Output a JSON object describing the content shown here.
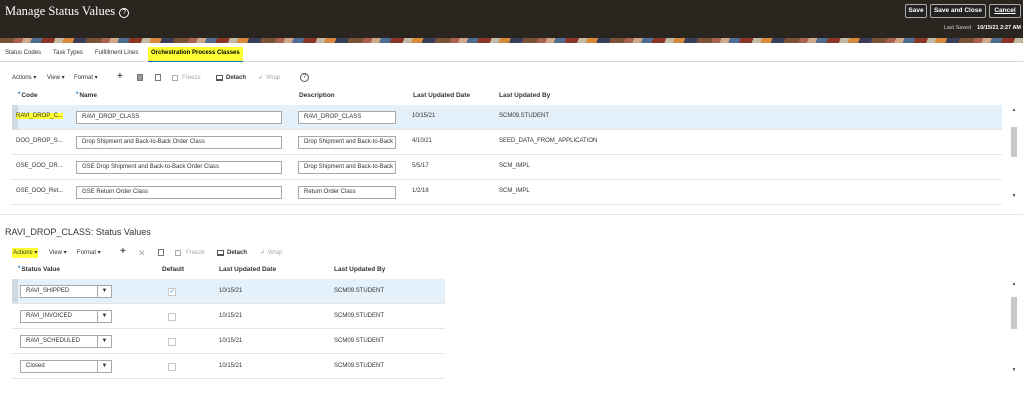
{
  "header": {
    "title": "Manage Status Values",
    "help_glyph": "?",
    "buttons": {
      "save": "Save",
      "save_close": "Save and Close",
      "cancel": "Cancel"
    },
    "last_saved_label": "Last Saved",
    "last_saved_value": "10/15/21 2:27 AM"
  },
  "tabs": [
    {
      "label": "Status Codes"
    },
    {
      "label": "Task Types"
    },
    {
      "label": "Fulfillment Lines"
    },
    {
      "label": "Orchestration Process Classes",
      "active": true
    }
  ],
  "toolbar1": {
    "actions": "Actions ▾",
    "view": "View ▾",
    "format": "Format ▾",
    "freeze": "Freeze",
    "detach": "Detach",
    "wrap": "Wrap"
  },
  "classes_table": {
    "columns": [
      "Code",
      "Name",
      "Description",
      "Last Updated Date",
      "Last Updated By"
    ],
    "rows": [
      {
        "code": "RAVI_DROP_C...",
        "name": "RAVI_DROP_CLASS",
        "description": "RAVI_DROP_CLASS",
        "date": "10/15/21",
        "by": "SCM09.STUDENT",
        "selected": true
      },
      {
        "code": "DOO_DROP_S...",
        "name": "Drop Shipment and Back-to-Back Order Class",
        "description": "Drop Shipment and Back-to-Back C",
        "date": "4/10/21",
        "by": "SEED_DATA_FROM_APPLICATION"
      },
      {
        "code": "GSE_DOO_DR...",
        "name": "GSE Drop Shipment and Back-to-Back Order Class",
        "description": "Drop Shipment and Back-to-Back C",
        "date": "5/5/17",
        "by": "SCM_IMPL"
      },
      {
        "code": "GSE_DOO_Ret...",
        "name": "GSE Return Order Class",
        "description": "Return Order Class",
        "date": "1/2/18",
        "by": "SCM_IMPL"
      }
    ]
  },
  "status_section": {
    "title": "RAVI_DROP_CLASS: Status Values"
  },
  "toolbar2": {
    "actions": "Actions ▾",
    "view": "View ▾",
    "format": "Format ▾",
    "freeze": "Freeze",
    "detach": "Detach",
    "wrap": "Wrap"
  },
  "status_table": {
    "columns": [
      "Status Value",
      "Default",
      "Last Updated Date",
      "Last Updated By"
    ],
    "rows": [
      {
        "value": "RAVI_SHIPPED",
        "default": true,
        "date": "10/15/21",
        "by": "SCM09.STUDENT",
        "selected": true
      },
      {
        "value": "RAVI_INVOICED",
        "default": false,
        "date": "10/15/21",
        "by": "SCM09.STUDENT"
      },
      {
        "value": "RAVI_SCHEDULED",
        "default": false,
        "date": "10/15/21",
        "by": "SCM09.STUDENT"
      },
      {
        "value": "Closed",
        "default": false,
        "date": "10/15/21",
        "by": "SCM09.STUDENT"
      }
    ]
  },
  "colors": {
    "highlight": "#ffff33",
    "header_bg": "#2b2520",
    "selected_row": "#e4f0fa",
    "accent": "#0572ce"
  }
}
